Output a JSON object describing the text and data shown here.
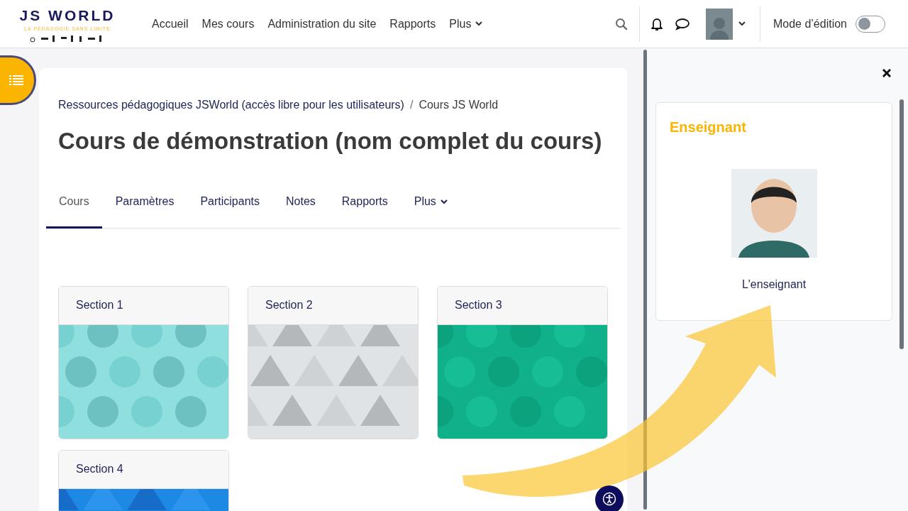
{
  "logo": {
    "name": "JS WORLD",
    "tagline": "LA PÉDAGOGIE SANS LIMITE"
  },
  "nav": [
    {
      "label": "Accueil",
      "dropdown": false
    },
    {
      "label": "Mes cours",
      "dropdown": false
    },
    {
      "label": "Administration du site",
      "dropdown": false
    },
    {
      "label": "Rapports",
      "dropdown": false
    },
    {
      "label": "Plus",
      "dropdown": true
    }
  ],
  "edit_mode": {
    "label": "Mode d’édition",
    "on": false
  },
  "breadcrumb": [
    "Ressources pédagogiques JSWorld (accès libre pour les utilisateurs)",
    "Cours JS World"
  ],
  "breadcrumb_separator": "/",
  "course_title": "Cours de démonstration (nom complet du cours)",
  "tabs": [
    {
      "label": "Cours",
      "selected": true,
      "dropdown": false
    },
    {
      "label": "Paramètres",
      "selected": false,
      "dropdown": false
    },
    {
      "label": "Participants",
      "selected": false,
      "dropdown": false
    },
    {
      "label": "Notes",
      "selected": false,
      "dropdown": false
    },
    {
      "label": "Rapports",
      "selected": false,
      "dropdown": false
    },
    {
      "label": "Plus",
      "selected": false,
      "dropdown": true
    }
  ],
  "sections": [
    {
      "title": "Section 1",
      "kind": "picture"
    },
    {
      "title": "Section 2",
      "kind": "picture"
    },
    {
      "title": "Section 3",
      "kind": "picture"
    },
    {
      "title": "Section 4",
      "kind": "picture"
    }
  ],
  "drawer": {
    "block_title": "Enseignant",
    "teacher_name": "L'enseignant"
  }
}
